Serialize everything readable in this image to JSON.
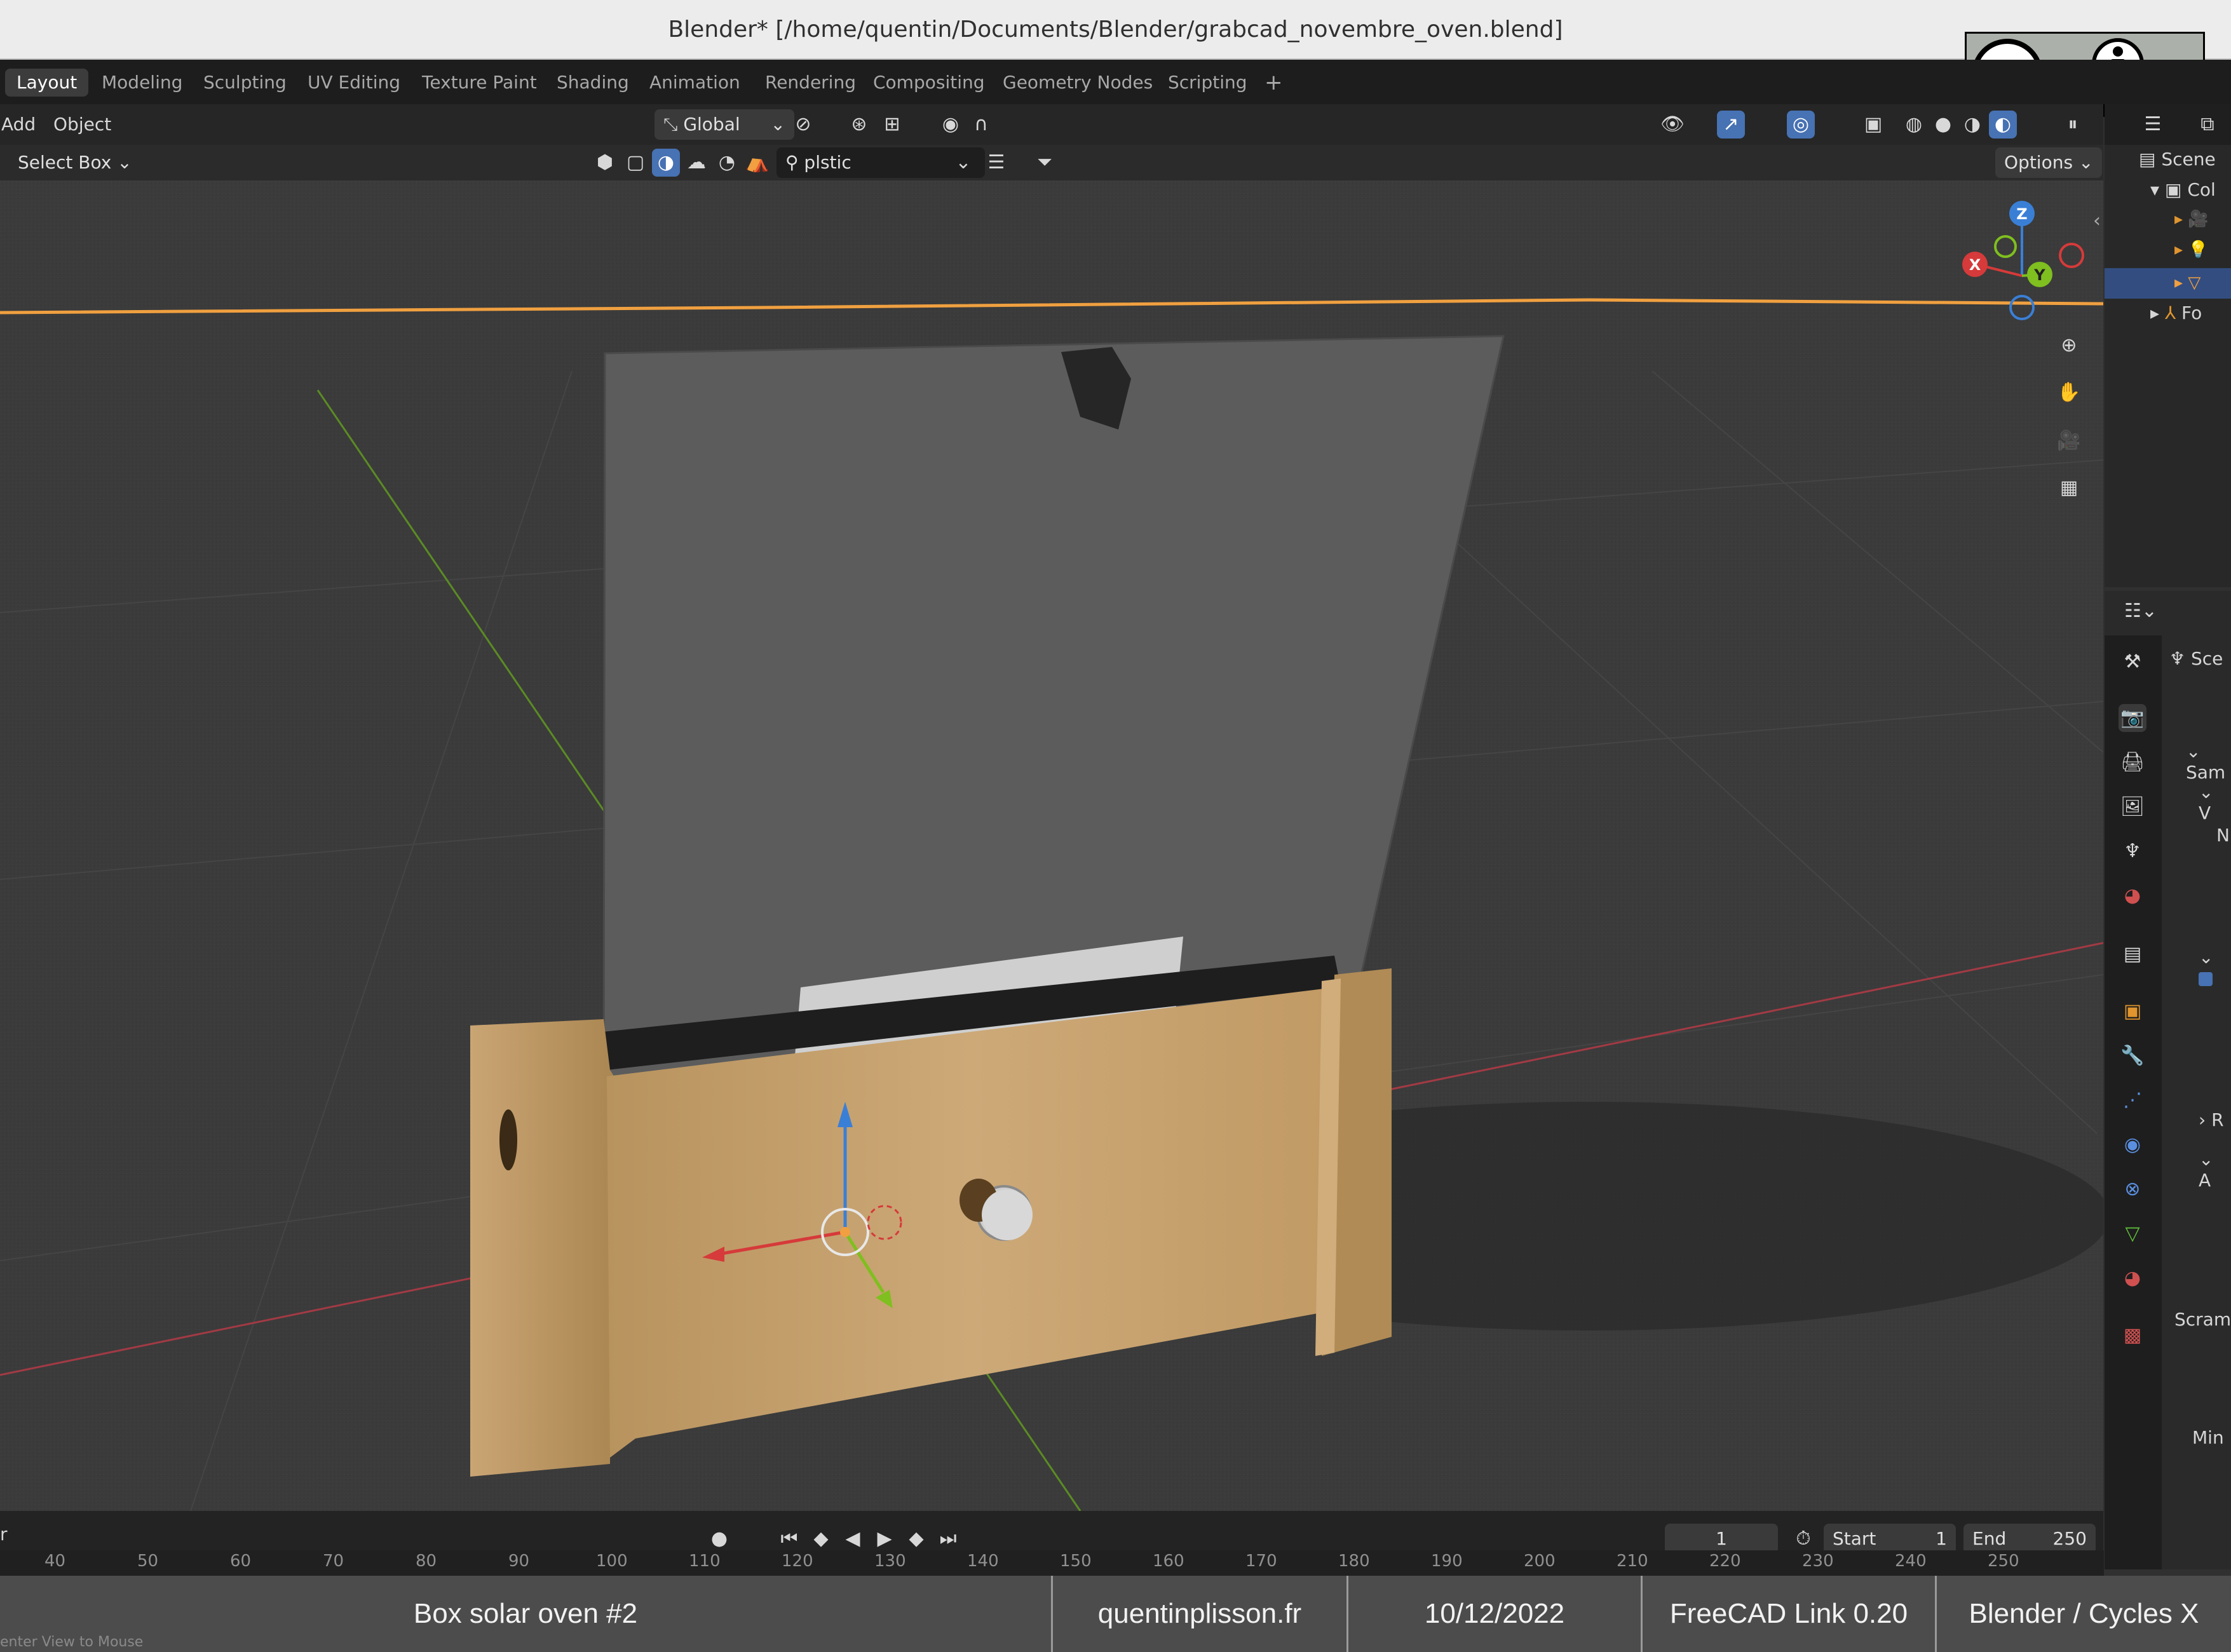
{
  "window": {
    "title": "Blender* [/home/quentin/Documents/Blender/grabcad_novembre_oven.blend]"
  },
  "workspace_tabs": [
    {
      "label": "Layout",
      "active": true
    },
    {
      "label": "Modeling"
    },
    {
      "label": "Sculpting"
    },
    {
      "label": "UV Editing"
    },
    {
      "label": "Texture Paint"
    },
    {
      "label": "Shading"
    },
    {
      "label": "Animation"
    },
    {
      "label": "Rendering"
    },
    {
      "label": "Compositing"
    },
    {
      "label": "Geometry Nodes"
    },
    {
      "label": "Scripting"
    }
  ],
  "add_tab_icon": "+",
  "header": {
    "menu_add": "Add",
    "menu_object": "Object",
    "transform_orientation": "Global",
    "select_mode": "Select Box",
    "search_text": "plstic",
    "options_label": "Options"
  },
  "license": {
    "badge_text": "BY",
    "cc_text": "cc"
  },
  "outliner": {
    "scene_label": "Scene",
    "collection_label": "Col",
    "item_fo": "Fo"
  },
  "properties": {
    "scene_label": "Sce",
    "section_sam": "Sam",
    "section_v": "V",
    "label_no": "N",
    "section_r": "R",
    "section_a": "A",
    "label_scram": "Scram",
    "label_min": "Min"
  },
  "timeline": {
    "left_label": "r",
    "current_frame": "1",
    "start_label": "Start",
    "start_value": "1",
    "end_label": "End",
    "end_value": "250",
    "ruler_ticks": [
      "40",
      "50",
      "60",
      "70",
      "80",
      "90",
      "100",
      "110",
      "120",
      "130",
      "140",
      "150",
      "160",
      "170",
      "180",
      "190",
      "200",
      "210",
      "220",
      "230",
      "240",
      "250"
    ],
    "status_hint": "enter View to Mouse"
  },
  "caption": [
    "Box solar oven #2",
    "quentinplisson.fr",
    "10/12/2022",
    "FreeCAD Link 0.20",
    "Blender / Cycles X"
  ],
  "colors": {
    "accent_blue": "#4772b3",
    "axis_x": "#d63a3a",
    "axis_y": "#7fbf1f",
    "axis_z": "#3a7fd6",
    "selection_orange": "#f0a040",
    "box_tan": "#c9a56e",
    "panel_gray": "#5a5a5a"
  }
}
